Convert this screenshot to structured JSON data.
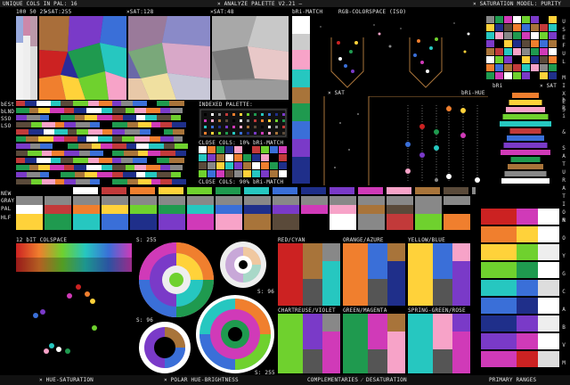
{
  "header": {
    "unique_cols": "UNIQUE COLS IN PAL: 16",
    "title": "× ANALYZE PALETTE V2.21 –",
    "sat_model": "× SATURATION MODEL: PURITY"
  },
  "sat_labels": {
    "small": "100 50 25 ",
    "s255": "×SAT:255",
    "s128": "×SAT:128",
    "s48": "×SAT:48",
    "bri_match": "bRi-MATCH",
    "rgb": "RGB-COLORSPACE (ISO)",
    "useful": "USEFUL MIXES",
    "bri_sat": "bRi & SATURATION"
  },
  "row_labels": {
    "best": "bESt",
    "blnd": "bLND",
    "sso": "SSO",
    "lso": "LSO",
    "new": "NEW",
    "gray": "GRAY",
    "pal": "PAL",
    "hlf": "HLF"
  },
  "indexed": {
    "title": "INDEXED PALETTE:",
    "close10": "CLOSE COLS: 10% bRi-MATCH",
    "close90": "CLOSE COLS: 90% bRi-MATCH"
  },
  "mid": {
    "sat_left": "× SAT",
    "bri_hue": "bRi-HUE",
    "bri_r": "bRi",
    "sat_r": "× SAT"
  },
  "colspace": {
    "title": "12 bIT COLSPACE",
    "s255a": "S: 255",
    "s96a": "S: 96",
    "s96b": "S: 96",
    "s255b": "S: 255"
  },
  "complements": [
    "RED/CYAN",
    "ORANGE/AZURE",
    "YELLOW/BLUE",
    "CHARTREUSE/VIOLET",
    "GREEN/MAGENTA",
    "SPRING-GREEN/ROSE"
  ],
  "ranges_letters": "R\nO\nY\nG\nC\nA\nB\nV\nM",
  "footer": {
    "hue_sat": "× HUE-SATURATION",
    "polar": "× POLAR HUE-BRIGHTNESS",
    "comp": "COMPLEMENTARIES ⁄ DESATURATION",
    "primary": "PRIMARY RANGES"
  },
  "palette": [
    "#000000",
    "#ffffff",
    "#888888",
    "#c23a3a",
    "#f07f2e",
    "#ffd23a",
    "#6fd12e",
    "#1f9a4f",
    "#26c7c0",
    "#3a6fd8",
    "#1f2f8a",
    "#7a3ac8",
    "#d03ab8",
    "#f7a3c8",
    "#a8743a",
    "#5a4a3a"
  ]
}
